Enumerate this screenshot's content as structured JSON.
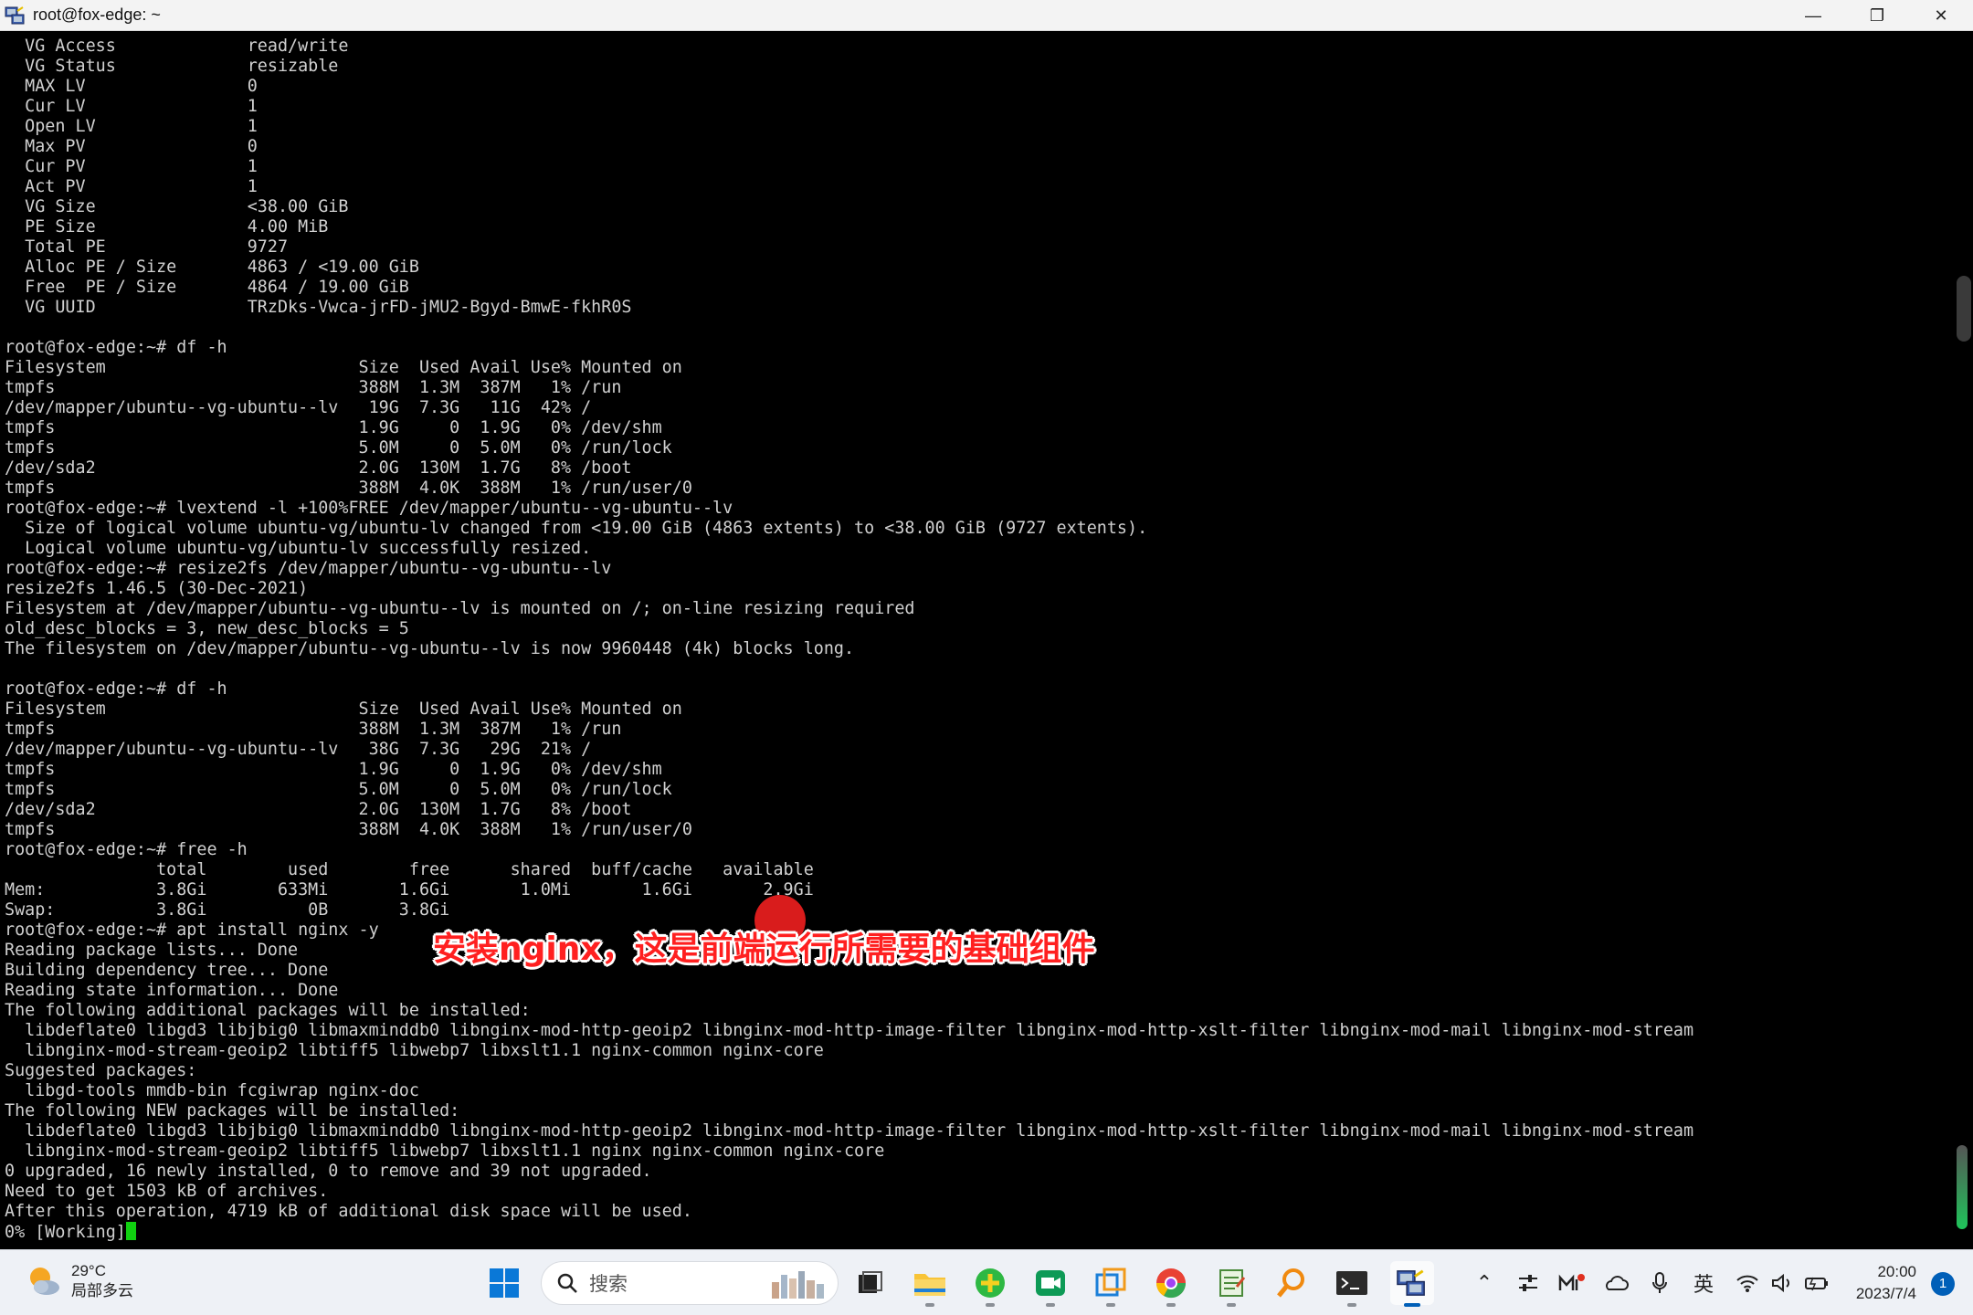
{
  "window": {
    "title": "root@fox-edge: ~"
  },
  "titlebar": {
    "minimize_glyph": "—",
    "maximize_glyph": "❐",
    "close_glyph": "✕"
  },
  "terminal": {
    "lines": [
      "  VG Access             read/write",
      "  VG Status             resizable",
      "  MAX LV                0",
      "  Cur LV                1",
      "  Open LV               1",
      "  Max PV                0",
      "  Cur PV                1",
      "  Act PV                1",
      "  VG Size               <38.00 GiB",
      "  PE Size               4.00 MiB",
      "  Total PE              9727",
      "  Alloc PE / Size       4863 / <19.00 GiB",
      "  Free  PE / Size       4864 / 19.00 GiB",
      "  VG UUID               TRzDks-Vwca-jrFD-jMU2-Bgyd-BmwE-fkhR0S",
      "",
      "root@fox-edge:~# df -h",
      "Filesystem                         Size  Used Avail Use% Mounted on",
      "tmpfs                              388M  1.3M  387M   1% /run",
      "/dev/mapper/ubuntu--vg-ubuntu--lv   19G  7.3G   11G  42% /",
      "tmpfs                              1.9G     0  1.9G   0% /dev/shm",
      "tmpfs                              5.0M     0  5.0M   0% /run/lock",
      "/dev/sda2                          2.0G  130M  1.7G   8% /boot",
      "tmpfs                              388M  4.0K  388M   1% /run/user/0",
      "root@fox-edge:~# lvextend -l +100%FREE /dev/mapper/ubuntu--vg-ubuntu--lv",
      "  Size of logical volume ubuntu-vg/ubuntu-lv changed from <19.00 GiB (4863 extents) to <38.00 GiB (9727 extents).",
      "  Logical volume ubuntu-vg/ubuntu-lv successfully resized.",
      "root@fox-edge:~# resize2fs /dev/mapper/ubuntu--vg-ubuntu--lv",
      "resize2fs 1.46.5 (30-Dec-2021)",
      "Filesystem at /dev/mapper/ubuntu--vg-ubuntu--lv is mounted on /; on-line resizing required",
      "old_desc_blocks = 3, new_desc_blocks = 5",
      "The filesystem on /dev/mapper/ubuntu--vg-ubuntu--lv is now 9960448 (4k) blocks long.",
      "",
      "root@fox-edge:~# df -h",
      "Filesystem                         Size  Used Avail Use% Mounted on",
      "tmpfs                              388M  1.3M  387M   1% /run",
      "/dev/mapper/ubuntu--vg-ubuntu--lv   38G  7.3G   29G  21% /",
      "tmpfs                              1.9G     0  1.9G   0% /dev/shm",
      "tmpfs                              5.0M     0  5.0M   0% /run/lock",
      "/dev/sda2                          2.0G  130M  1.7G   8% /boot",
      "tmpfs                              388M  4.0K  388M   1% /run/user/0",
      "root@fox-edge:~# free -h",
      "               total        used        free      shared  buff/cache   available",
      "Mem:           3.8Gi       633Mi       1.6Gi       1.0Mi       1.6Gi       2.9Gi",
      "Swap:          3.8Gi          0B       3.8Gi",
      "root@fox-edge:~# apt install nginx -y",
      "Reading package lists... Done",
      "Building dependency tree... Done",
      "Reading state information... Done",
      "The following additional packages will be installed:",
      "  libdeflate0 libgd3 libjbig0 libmaxminddb0 libnginx-mod-http-geoip2 libnginx-mod-http-image-filter libnginx-mod-http-xslt-filter libnginx-mod-mail libnginx-mod-stream",
      "  libnginx-mod-stream-geoip2 libtiff5 libwebp7 libxslt1.1 nginx-common nginx-core",
      "Suggested packages:",
      "  libgd-tools mmdb-bin fcgiwrap nginx-doc",
      "The following NEW packages will be installed:",
      "  libdeflate0 libgd3 libjbig0 libmaxminddb0 libnginx-mod-http-geoip2 libnginx-mod-http-image-filter libnginx-mod-http-xslt-filter libnginx-mod-mail libnginx-mod-stream",
      "  libnginx-mod-stream-geoip2 libtiff5 libwebp7 libxslt1.1 nginx nginx-common nginx-core",
      "0 upgraded, 16 newly installed, 0 to remove and 39 not upgraded.",
      "Need to get 1503 kB of archives.",
      "After this operation, 4719 kB of additional disk space will be used.",
      "0% [Working]"
    ]
  },
  "subtitle": "安装nginx，这是前端运行所需要的基础组件",
  "taskbar": {
    "weather": {
      "temp": "29°C",
      "desc": "局部多云",
      "icon": "partly-cloudy-icon"
    },
    "search_placeholder": "搜索",
    "tray": {
      "ime": "英"
    },
    "clock": {
      "time": "20:00",
      "date": "2023/7/4"
    },
    "notification_count": "1"
  }
}
